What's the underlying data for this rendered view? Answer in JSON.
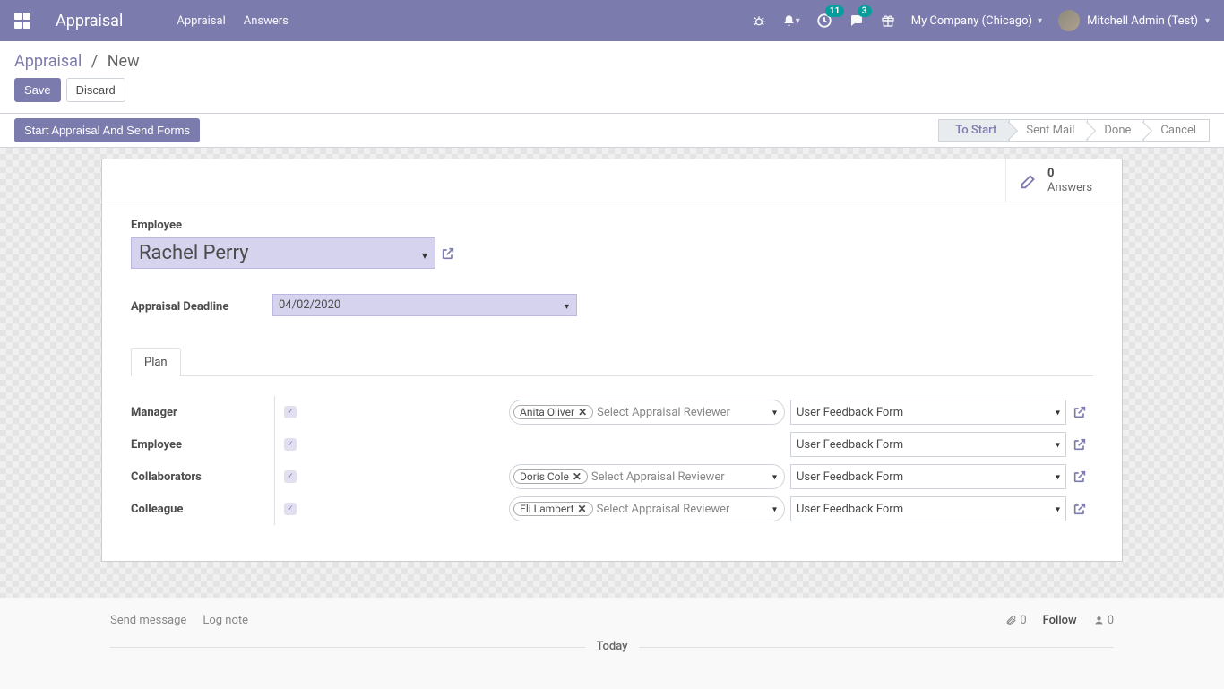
{
  "navbar": {
    "app_title": "Appraisal",
    "links": [
      "Appraisal",
      "Answers"
    ],
    "activity_badge": "11",
    "messages_badge": "3",
    "company": "My Company (Chicago)",
    "user": "Mitchell Admin (Test)"
  },
  "breadcrumb": {
    "root": "Appraisal",
    "current": "New"
  },
  "buttons": {
    "save": "Save",
    "discard": "Discard",
    "start": "Start Appraisal And Send Forms"
  },
  "stages": {
    "to_start": "To Start",
    "sent_mail": "Sent Mail",
    "done": "Done",
    "cancel": "Cancel"
  },
  "stat": {
    "count": "0",
    "label": "Answers"
  },
  "form": {
    "employee_label": "Employee",
    "employee_value": "Rachel Perry",
    "deadline_label": "Appraisal Deadline",
    "deadline_value": "04/02/2020"
  },
  "tabs": {
    "plan": "Plan"
  },
  "plan": {
    "reviewer_placeholder": "Select Appraisal Reviewer",
    "form_option": "User Feedback Form",
    "rows": [
      {
        "label": "Manager",
        "tag": "Anita Oliver",
        "has_reviewer": true
      },
      {
        "label": "Employee",
        "tag": "",
        "has_reviewer": false
      },
      {
        "label": "Collaborators",
        "tag": "Doris Cole",
        "has_reviewer": true
      },
      {
        "label": "Colleague",
        "tag": "Eli Lambert",
        "has_reviewer": true
      }
    ]
  },
  "chatter": {
    "send": "Send message",
    "log": "Log note",
    "attach_count": "0",
    "follow": "Follow",
    "follower_count": "0",
    "today": "Today"
  }
}
